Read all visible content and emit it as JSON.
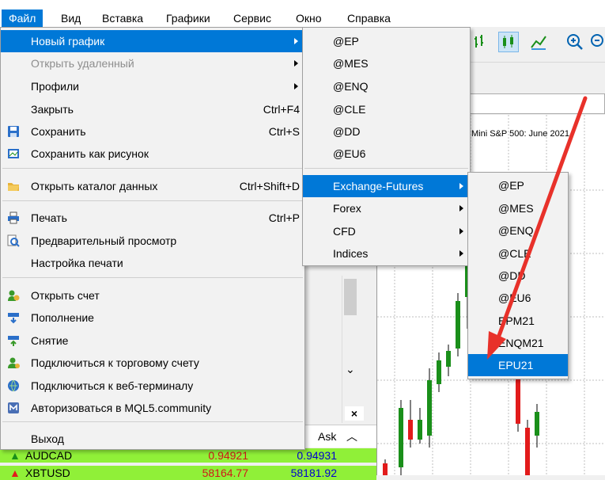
{
  "menubar": [
    {
      "label": "Файл",
      "active": true
    },
    {
      "label": "Вид"
    },
    {
      "label": "Вставка"
    },
    {
      "label": "Графики"
    },
    {
      "label": "Сервис"
    },
    {
      "label": "Окно"
    },
    {
      "label": "Справка"
    }
  ],
  "file_menu": [
    {
      "label": "Новый график",
      "submenu": true,
      "highlight": true
    },
    {
      "label": "Открыть удаленный",
      "submenu": true,
      "disabled": true
    },
    {
      "label": "Профили",
      "submenu": true
    },
    {
      "label": "Закрыть",
      "shortcut": "Ctrl+F4"
    },
    {
      "label": "Сохранить",
      "shortcut": "Ctrl+S",
      "icon": "save-icon"
    },
    {
      "label": "Сохранить как рисунок",
      "icon": "save-picture-icon"
    },
    {
      "label": "Открыть каталог данных",
      "shortcut": "Ctrl+Shift+D",
      "icon": "folder-icon"
    },
    {
      "label": "Печать",
      "shortcut": "Ctrl+P",
      "icon": "print-icon"
    },
    {
      "label": "Предварительный просмотр",
      "icon": "print-preview-icon"
    },
    {
      "label": "Настройка печати"
    },
    {
      "label": "Открыть счет",
      "icon": "open-account-icon"
    },
    {
      "label": "Пополнение",
      "icon": "deposit-icon"
    },
    {
      "label": "Снятие",
      "icon": "withdraw-icon"
    },
    {
      "label": "Подключиться к торговому счету",
      "icon": "connect-account-icon"
    },
    {
      "label": "Подключиться к веб-терминалу",
      "icon": "web-terminal-icon"
    },
    {
      "label": "Авторизоваться в MQL5.community",
      "icon": "mql5-icon"
    },
    {
      "label": "Выход"
    }
  ],
  "new_chart_menu": [
    {
      "label": "@EP"
    },
    {
      "label": "@MES"
    },
    {
      "label": "@ENQ"
    },
    {
      "label": "@CLE"
    },
    {
      "label": "@DD"
    },
    {
      "label": "@EU6"
    },
    {
      "label": "Exchange-Futures",
      "submenu": true,
      "highlight": true
    },
    {
      "label": "Forex",
      "submenu": true
    },
    {
      "label": "CFD",
      "submenu": true
    },
    {
      "label": "Indices",
      "submenu": true
    }
  ],
  "exchange_menu": [
    {
      "label": "@EP"
    },
    {
      "label": "@MES"
    },
    {
      "label": "@ENQ"
    },
    {
      "label": "@CLE"
    },
    {
      "label": "@DD"
    },
    {
      "label": "@EU6"
    },
    {
      "label": "EPM21"
    },
    {
      "label": "ENQM21"
    },
    {
      "label": "EPU21",
      "highlight": true
    }
  ],
  "chart": {
    "title": "Mini S&P 500: June 2021"
  },
  "market_watch": {
    "ask_header": "Ask",
    "rows": [
      {
        "symbol": "AUDCAD",
        "bid": "0.94921",
        "ask": "0.94931"
      },
      {
        "symbol": "XBTUSD",
        "bid": "58164.77",
        "ask": "58181.92"
      }
    ]
  },
  "colors": {
    "accent": "#0078d7",
    "arrow": "#e8312a",
    "bull": "#1a8f1a",
    "bear": "#e21b1b"
  }
}
